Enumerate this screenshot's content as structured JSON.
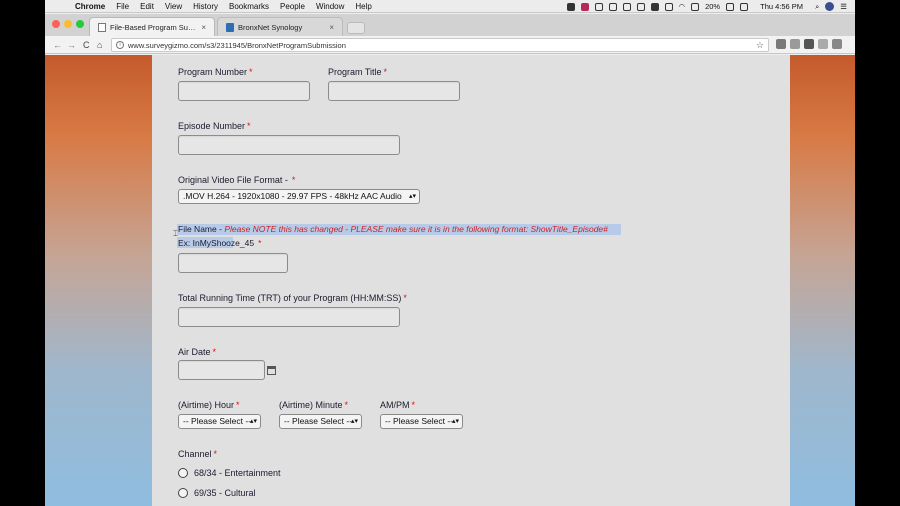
{
  "menubar": {
    "items": [
      "Chrome",
      "File",
      "Edit",
      "View",
      "History",
      "Bookmarks",
      "People",
      "Window",
      "Help"
    ],
    "battery": "20%",
    "clock": "Thu 4:56 PM"
  },
  "tabs": [
    {
      "title": "File-Based Program Submissio",
      "close": "×"
    },
    {
      "title": "BronxNet Synology",
      "close": "×"
    }
  ],
  "toolbar": {
    "back": "←",
    "forward": "→",
    "reload": "C",
    "home": "⌂",
    "url": "www.surveygizmo.com/s3/2311945/BronxNetProgramSubmission",
    "star": "☆"
  },
  "form": {
    "program_number_label": "Program Number",
    "program_title_label": "Program Title",
    "episode_number_label": "Episode Number",
    "video_format_label": "Original Video File Format -",
    "video_format_value": ".MOV H.264 - 1920x1080 - 29.97 FPS - 48kHz AAC Audio",
    "file_name_label": "File Name -",
    "file_name_note": "Please NOTE this has changed - PLEASE make sure it is in the following format:  ShowTitle_Episode#",
    "file_name_example": "Ex:  InMyShooze_45",
    "trt_label": "Total Running Time (TRT) of your Program  (HH:MM:SS)",
    "air_date_label": "Air Date",
    "hour_label": "(Airtime) Hour",
    "minute_label": "(Airtime) Minute",
    "ampm_label": "AM/PM",
    "please_select": "-- Please Select --",
    "channel_label": "Channel",
    "channel_options": [
      "68/34 - Entertainment",
      "69/35 - Cultural"
    ],
    "required_mark": "*"
  },
  "colors": {
    "required": "#dd1111",
    "note": "#cc2222",
    "highlight": "#b7cbe8"
  }
}
